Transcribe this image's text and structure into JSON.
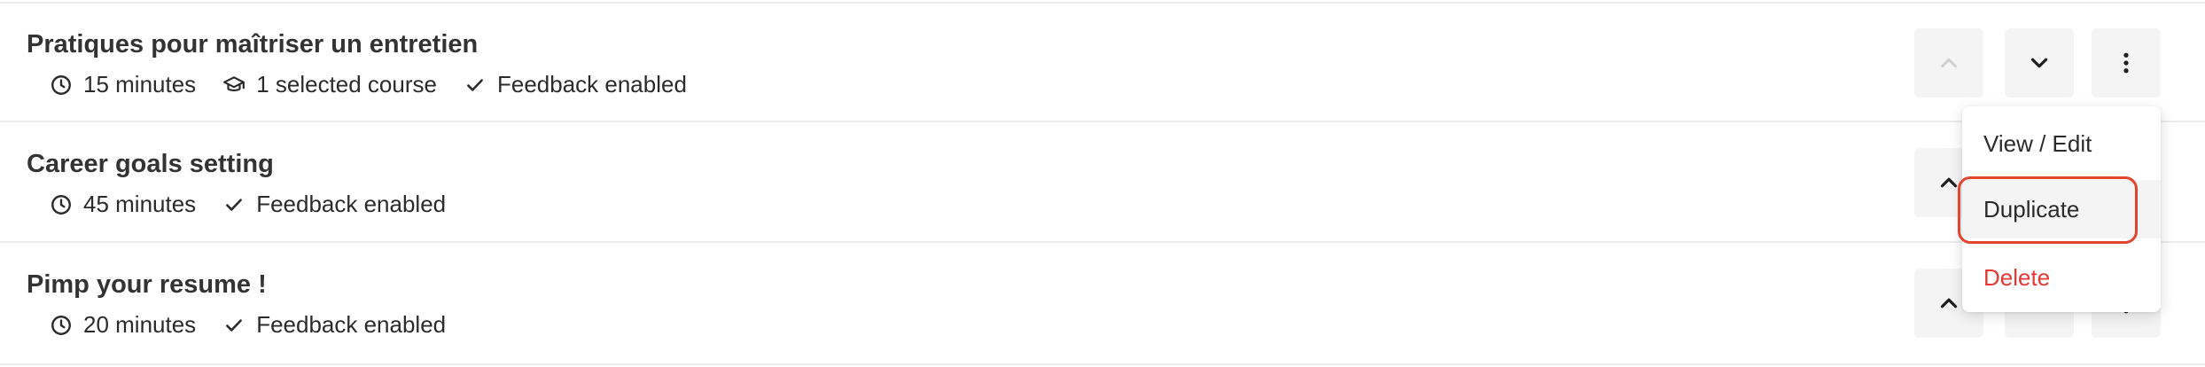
{
  "rows": [
    {
      "title": "Pratiques pour maîtriser un entretien",
      "duration": "15 minutes",
      "course": "1 selected course",
      "feedback": "Feedback enabled"
    },
    {
      "title": "Career goals setting",
      "duration": "45 minutes",
      "feedback": "Feedback enabled"
    },
    {
      "title": "Pimp your resume !",
      "duration": "20 minutes",
      "feedback": "Feedback enabled"
    }
  ],
  "menu": {
    "items": [
      "View / Edit",
      "Duplicate",
      "Delete"
    ],
    "highlighted": "Duplicate"
  },
  "icons": {
    "duration": "clock-icon",
    "course": "graduation-cap-icon",
    "feedback": "check-icon",
    "move_up": "chevron-up-icon",
    "move_down": "chevron-down-icon",
    "more": "more-vertical-icon"
  },
  "colors": {
    "danger": "#e53935",
    "highlight_ring": "#e2452e",
    "button_bg": "#f4f4f5"
  }
}
